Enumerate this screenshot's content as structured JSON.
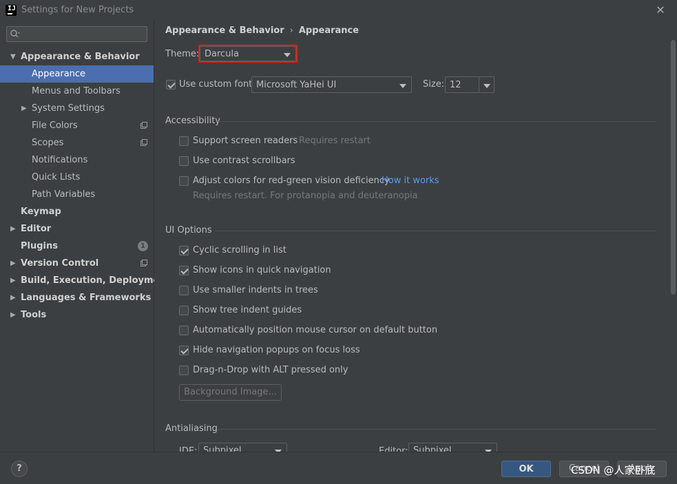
{
  "window": {
    "title": "Settings for New Projects",
    "icon_text": "IJ"
  },
  "sidebar": {
    "search_placeholder": "",
    "items": [
      {
        "label": "Appearance & Behavior",
        "expanded": true,
        "bold": true
      },
      {
        "label": "Appearance",
        "selected": true
      },
      {
        "label": "Menus and Toolbars"
      },
      {
        "label": "System Settings",
        "collapsed": true
      },
      {
        "label": "File Colors",
        "project_icon": true
      },
      {
        "label": "Scopes",
        "project_icon": true
      },
      {
        "label": "Notifications"
      },
      {
        "label": "Quick Lists"
      },
      {
        "label": "Path Variables"
      },
      {
        "label": "Keymap",
        "bold": true
      },
      {
        "label": "Editor",
        "bold": true
      },
      {
        "label": "Plugins",
        "bold": true,
        "badge": "1"
      },
      {
        "label": "Version Control",
        "bold": true,
        "project_icon": true
      },
      {
        "label": "Build, Execution, Deployment",
        "bold": true
      },
      {
        "label": "Languages & Frameworks",
        "bold": true
      },
      {
        "label": "Tools",
        "bold": true
      }
    ]
  },
  "main": {
    "breadcrumb": {
      "parent": "Appearance & Behavior",
      "separator": "›",
      "current": "Appearance"
    },
    "theme": {
      "label": "Theme:",
      "value": "Darcula"
    },
    "custom_font": {
      "checked": true,
      "label": "Use custom font:",
      "value": "Microsoft YaHei UI",
      "size_label": "Size:",
      "size_value": "12"
    },
    "accessibility": {
      "title": "Accessibility",
      "screen_readers": {
        "checked": false,
        "label": "Support screen readers",
        "hint": "Requires restart"
      },
      "contrast_scrollbars": {
        "checked": false,
        "label": "Use contrast scrollbars"
      },
      "red_green": {
        "checked": false,
        "label": "Adjust colors for red-green vision deficiency",
        "link": "How it works",
        "hint": "Requires restart. For protanopia and deuteranopia"
      }
    },
    "ui_options": {
      "title": "UI Options",
      "options": [
        {
          "checked": true,
          "label": "Cyclic scrolling in list"
        },
        {
          "checked": true,
          "label": "Show icons in quick navigation"
        },
        {
          "checked": false,
          "label": "Use smaller indents in trees"
        },
        {
          "checked": false,
          "label": "Show tree indent guides"
        },
        {
          "checked": false,
          "label": "Automatically position mouse cursor on default button"
        },
        {
          "checked": true,
          "label": "Hide navigation popups on focus loss"
        },
        {
          "checked": false,
          "label": "Drag-n-Drop with ALT pressed only"
        }
      ],
      "background_image_button": "Background Image..."
    },
    "antialiasing": {
      "title": "Antialiasing",
      "ide_label": "IDE:",
      "ide_value": "Subpixel",
      "editor_label": "Editor:",
      "editor_value": "Subpixel"
    }
  },
  "footer": {
    "help": "?",
    "ok": "OK",
    "cancel": "Cancel",
    "apply": "Apply",
    "watermark": "CSDN @人家卧底"
  },
  "colors": {
    "accent_selected": "#4b6eaf",
    "highlight_border": "#e0201e",
    "link": "#589df6",
    "ok_button": "#365880"
  }
}
